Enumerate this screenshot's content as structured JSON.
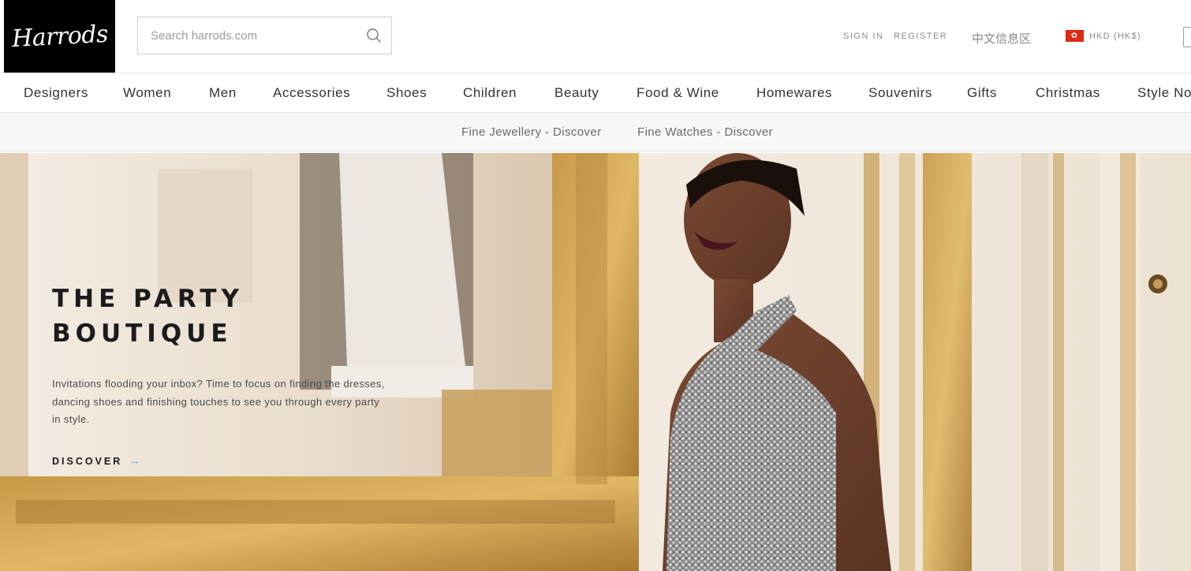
{
  "header": {
    "logo_text": "Harrods",
    "search_placeholder": "Search harrods.com",
    "search_icon": "search-icon",
    "sign_in": "SIGN IN",
    "register": "REGISTER",
    "chinese_link": "中文信息区",
    "currency": "HKD (HK$)",
    "flag_icon": "hong-kong-flag-icon",
    "bag_icon": "shopping-bag-icon"
  },
  "nav": {
    "items": [
      "Designers",
      "Women",
      "Men",
      "Accessories",
      "Shoes",
      "Children",
      "Beauty",
      "Food & Wine",
      "Homewares",
      "Souvenirs",
      "Gifts",
      "Christmas",
      "Style No"
    ]
  },
  "subnav": {
    "items": [
      "Fine Jewellery - Discover",
      "Fine Watches - Discover"
    ]
  },
  "hero": {
    "title": "THE PARTY\nBOUTIQUE",
    "description": "Invitations flooding your inbox? Time to focus on finding the dresses, dancing shoes and finishing touches to see you through every party in style.",
    "cta_label": "DISCOVER",
    "cta_arrow": "→"
  },
  "colors": {
    "logo_bg": "#000000",
    "accent_arrow": "#6fb4c4",
    "flag_red": "#de2910"
  }
}
